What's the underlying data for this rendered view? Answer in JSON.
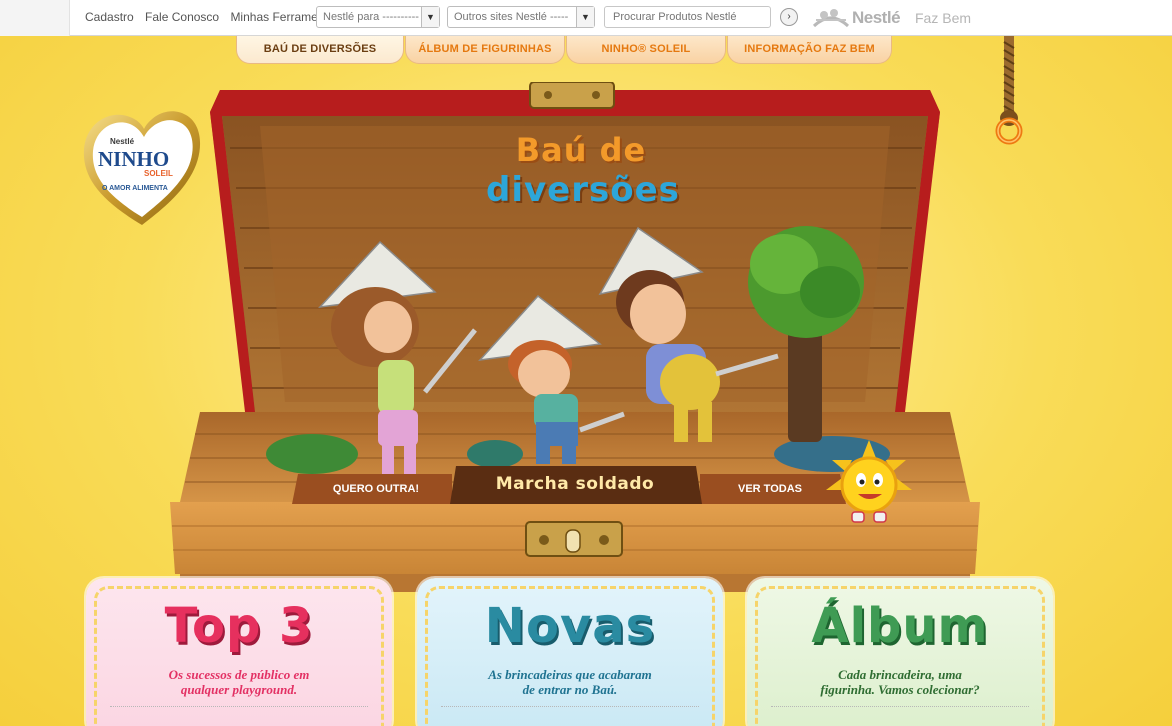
{
  "topbar": {
    "links": [
      "Cadastro",
      "Fale Conosco",
      "Minhas Ferramentas"
    ],
    "select1": "Nestlé para ----------",
    "select2": "Outros sites Nestlé -----",
    "search_placeholder": "Procurar Produtos Nestlé",
    "brand": "Nestlé",
    "tagline": "Faz Bem"
  },
  "tabs": [
    {
      "label": "Baú de Diversões"
    },
    {
      "label": "Álbum de Figurinhas"
    },
    {
      "label": "Ninho® Soleil"
    },
    {
      "label": "Informação Faz Bem"
    }
  ],
  "logo": {
    "brand_small": "Nestlé",
    "name": "NINHO",
    "sub": "SOLEIL",
    "slogan": "O AMOR ALIMENTA"
  },
  "chest": {
    "title_line1": "Baú de",
    "title_line2": "diversões",
    "btn_left": "QUERO OUTRA!",
    "current_game": "Marcha soldado",
    "btn_right": "VER TODAS"
  },
  "cards": [
    {
      "title": "Top 3",
      "line1": "Os sucessos de público em",
      "line2": "qualquer playground."
    },
    {
      "title": "Novas",
      "line1": "As brincadeiras que acabaram",
      "line2": "de entrar no Baú."
    },
    {
      "title": "Álbum",
      "line1": "Cada brincadeira, uma",
      "line2": "figurinha. Vamos colecionar?"
    }
  ],
  "colors": {
    "background": "#f9dc58",
    "tab_text": "#e57910",
    "wood": "#d08a3c",
    "chest_rim": "#b71d1d"
  },
  "icons": [
    "nestle-nest-icon",
    "search-go-icon",
    "chevron-down-icon",
    "rope-icon",
    "sun-mascot-icon"
  ]
}
